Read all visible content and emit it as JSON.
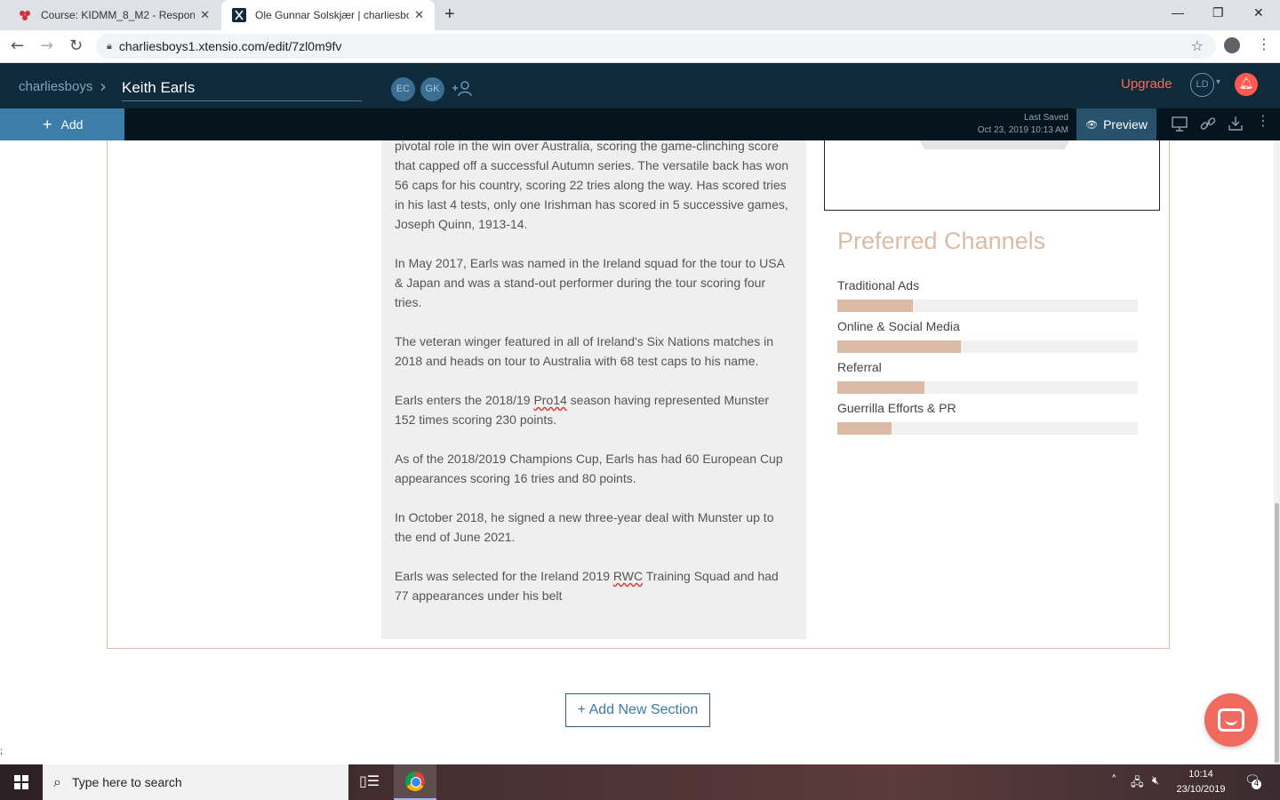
{
  "browser": {
    "tabs": [
      {
        "title": "Course: KIDMM_8_M2 - Responsi",
        "active": false
      },
      {
        "title": "Ole Gunnar Solskjær | charliesbo",
        "active": true
      }
    ],
    "url": "charliesboys1.xtensio.com/edit/7zl0m9fv"
  },
  "app": {
    "workspace": "charliesboys",
    "document_name": "Keith Earls",
    "collaborators": [
      "EC",
      "GK"
    ],
    "upgrade_label": "Upgrade",
    "user_initials": "LD"
  },
  "toolbar": {
    "add_label": "Add",
    "last_saved_label": "Last Saved",
    "last_saved_time": "Oct 23, 2019 10:13 AM",
    "preview_label": "Preview"
  },
  "bio": {
    "paragraphs": [
      "pivotal role in the win over Australia, scoring the game-clinching score that capped off a successful Autumn series. The versatile back has won 56 caps for his country, scoring 22 tries along the way. Has scored tries in his last 4 tests, only one Irishman has scored in 5 successive games, Joseph Quinn, 1913-14.",
      "In May 2017, Earls was named in the Ireland squad for the tour to USA & Japan and was a stand-out performer during the tour scoring four tries.",
      "The veteran winger featured in all of Ireland's Six Nations matches in 2018 and heads on tour to Australia with 68 test caps to his name.",
      "Earls enters the 2018/19 Pro14 season having represented Munster 152 times scoring 230 points.",
      "As of the 2018/2019 Champions Cup, Earls has had 60 European Cup appearances scoring 16 tries and 80 points.",
      "In October 2018, he signed a new three-year deal with Munster up to the end of June 2021.",
      "Earls was selected for the Ireland 2019 RWC Training Squad and had 77 appearances under his belt"
    ]
  },
  "channels": {
    "title": "Preferred Channels",
    "fill_color": "#dcbba6",
    "items": [
      {
        "label": "Traditional Ads",
        "level": 0.25
      },
      {
        "label": "Online & Social Media",
        "level": 0.41
      },
      {
        "label": "Referral",
        "level": 0.29
      },
      {
        "label": "Guerrilla Efforts & PR",
        "level": 0.18
      }
    ]
  },
  "add_section_label": "+ Add New Section",
  "page_footer_mark": ";",
  "taskbar": {
    "search_placeholder": "Type here to search",
    "time": "10:14",
    "date": "23/10/2019",
    "notification_count": "4"
  }
}
